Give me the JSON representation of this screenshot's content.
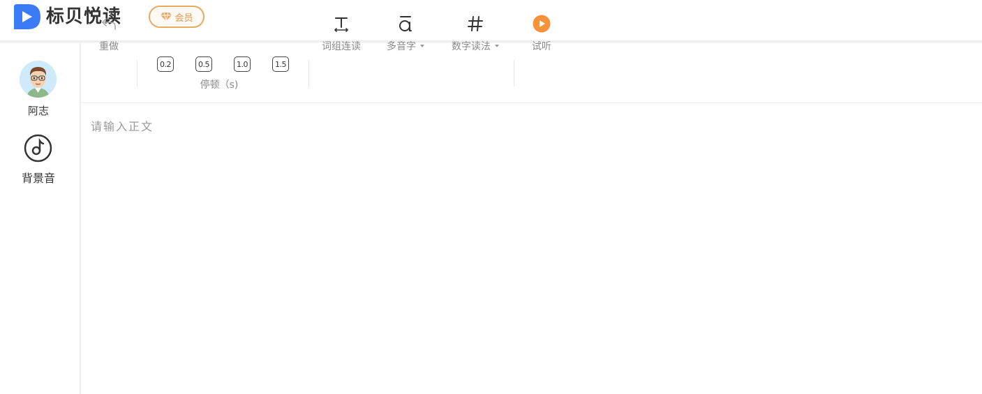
{
  "header": {
    "app_title": "标贝悦读",
    "vip_label": "会员",
    "colors": {
      "brand_blue": "#3b7cf6",
      "vip_orange": "#e9a964"
    }
  },
  "sidebar": {
    "voice_name": "阿志",
    "bgm_label": "背景音"
  },
  "toolbar": {
    "redo_label": "重做",
    "pause_values": [
      "0.2",
      "0.5",
      "1.0",
      "1.5"
    ],
    "pause_label": "停顿（s)",
    "word_group_label": "词组连读",
    "polyphone_label": "多音字",
    "number_reading_label": "数字读法",
    "preview_label": "试听",
    "colors": {
      "preview_orange": "#f7923a"
    }
  },
  "editor": {
    "placeholder": "请输入正文",
    "value": ""
  }
}
